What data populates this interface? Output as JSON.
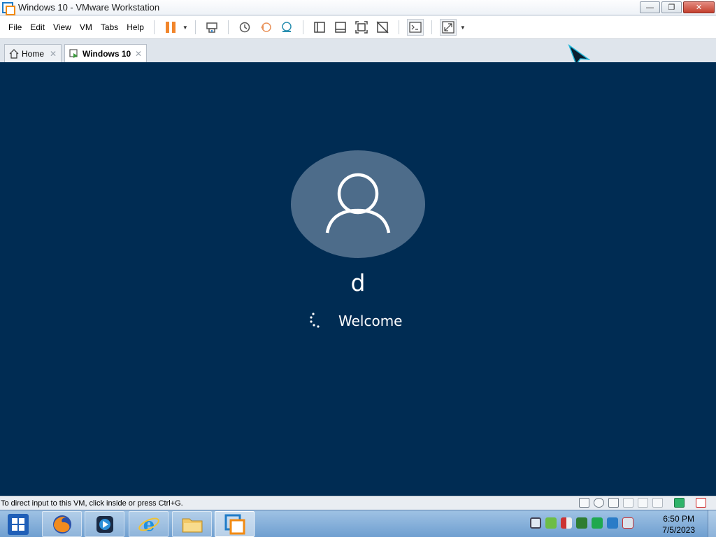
{
  "window": {
    "title": "Windows 10 - VMware Workstation",
    "minimize_label": "—",
    "restore_label": "❐",
    "close_label": "✕"
  },
  "menu": {
    "items": [
      "File",
      "Edit",
      "View",
      "VM",
      "Tabs",
      "Help"
    ]
  },
  "toolbar": {
    "icons": [
      "pause-icon",
      "send-ctrl-alt-del-icon",
      "snapshot-icon",
      "revert-snapshot-icon",
      "snapshot-manager-icon",
      "show-library-icon",
      "thumbnail-icon",
      "full-screen-icon",
      "unity-icon",
      "console-view-icon",
      "stretch-guest-icon"
    ]
  },
  "tabs": [
    {
      "label": "Home",
      "close": "✕"
    },
    {
      "label": "Windows 10",
      "close": "✕"
    }
  ],
  "vm": {
    "user_name": "d",
    "status_text": "Welcome",
    "background": "#002c53"
  },
  "statusbar": {
    "message": "To direct input to this VM, click inside or press Ctrl+G."
  },
  "taskbar": {
    "apps": [
      "firefox-icon",
      "media-player-icon",
      "internet-explorer-icon",
      "file-explorer-icon",
      "vmware-workstation-icon"
    ],
    "time": "6:50 PM",
    "date": "7/5/2023"
  },
  "colors": {
    "vm_background": "#002c53",
    "accent_orange": "#f1852b",
    "avatar_fill": "#4d6c8a"
  }
}
